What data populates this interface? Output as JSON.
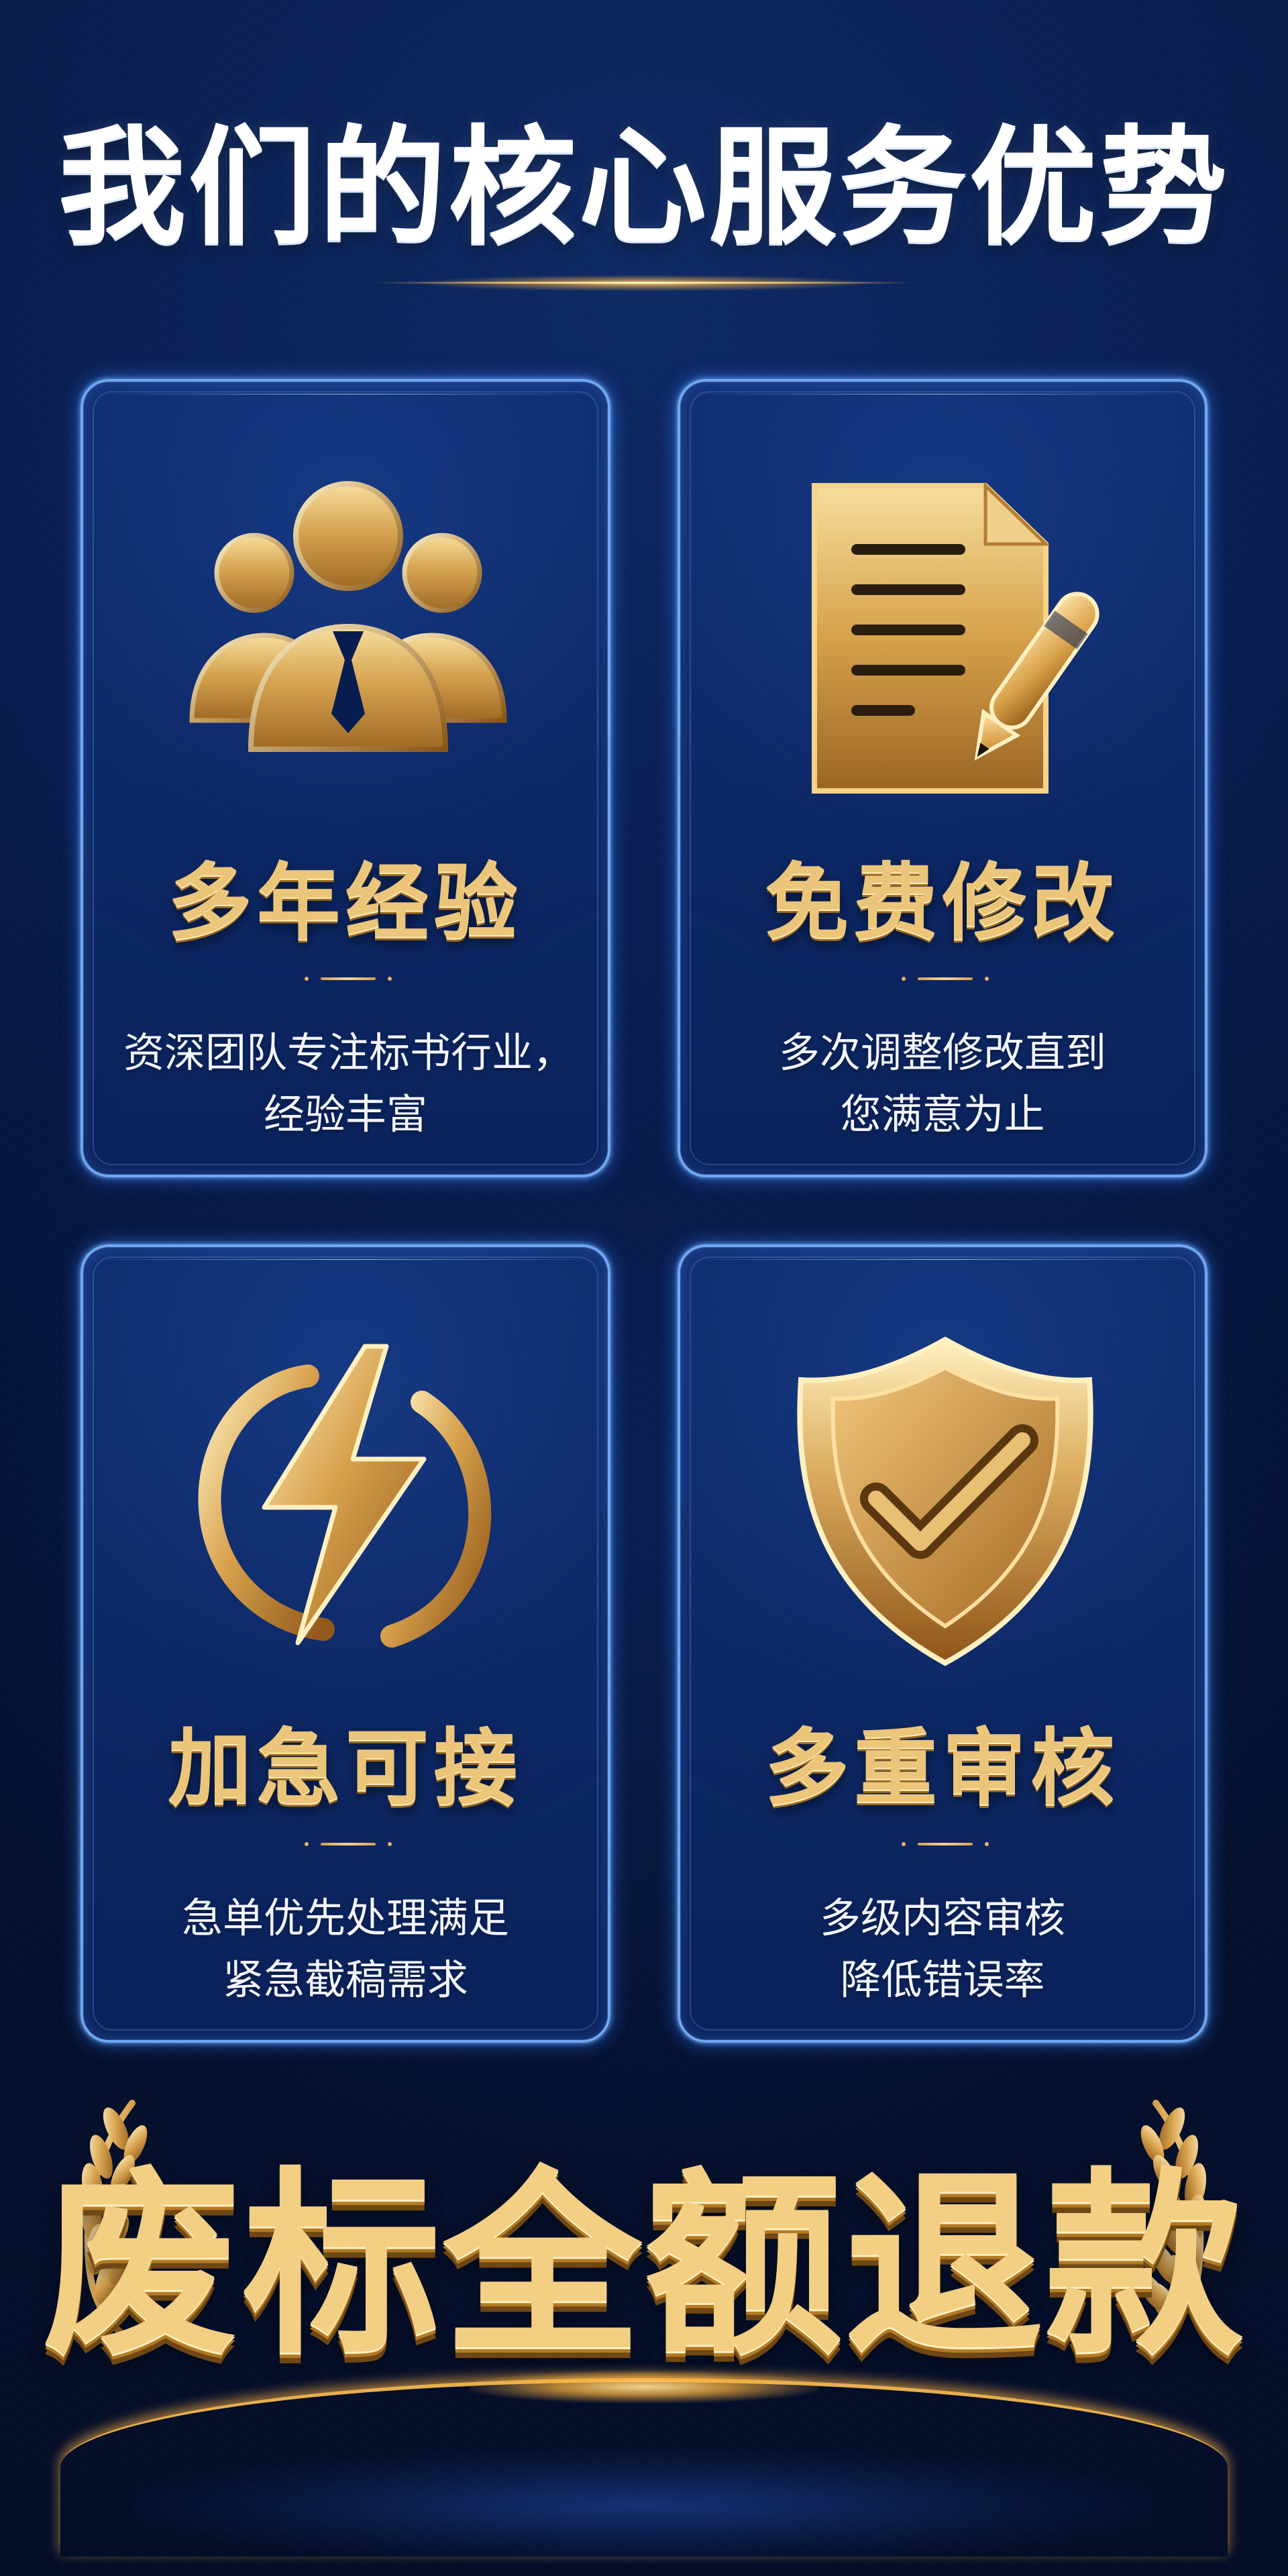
{
  "title": "我们的核心服务优势",
  "cards": [
    {
      "title": "多年经验",
      "description": [
        "资深团队专注标书行业，",
        "经验丰富"
      ],
      "icon": "team-icon"
    },
    {
      "title": "免费修改",
      "description": [
        "多次调整修改直到",
        "您满意为止"
      ],
      "icon": "document-pen-icon"
    },
    {
      "title": "加急可接",
      "description": [
        "急单优先处理满足",
        "紧急截稿需求"
      ],
      "icon": "lightning-icon"
    },
    {
      "title": "多重审核",
      "description": [
        "多级内容审核",
        "降低错误率"
      ],
      "icon": "shield-check-icon"
    }
  ],
  "banner": {
    "text": "废标全额退款",
    "decor": [
      "laurel-icon",
      "laurel-icon"
    ]
  },
  "colors": {
    "background": "#061233",
    "card_border": "#7bb5ff",
    "gold": "#ebc57a",
    "white_text": "#f2f5ff"
  }
}
